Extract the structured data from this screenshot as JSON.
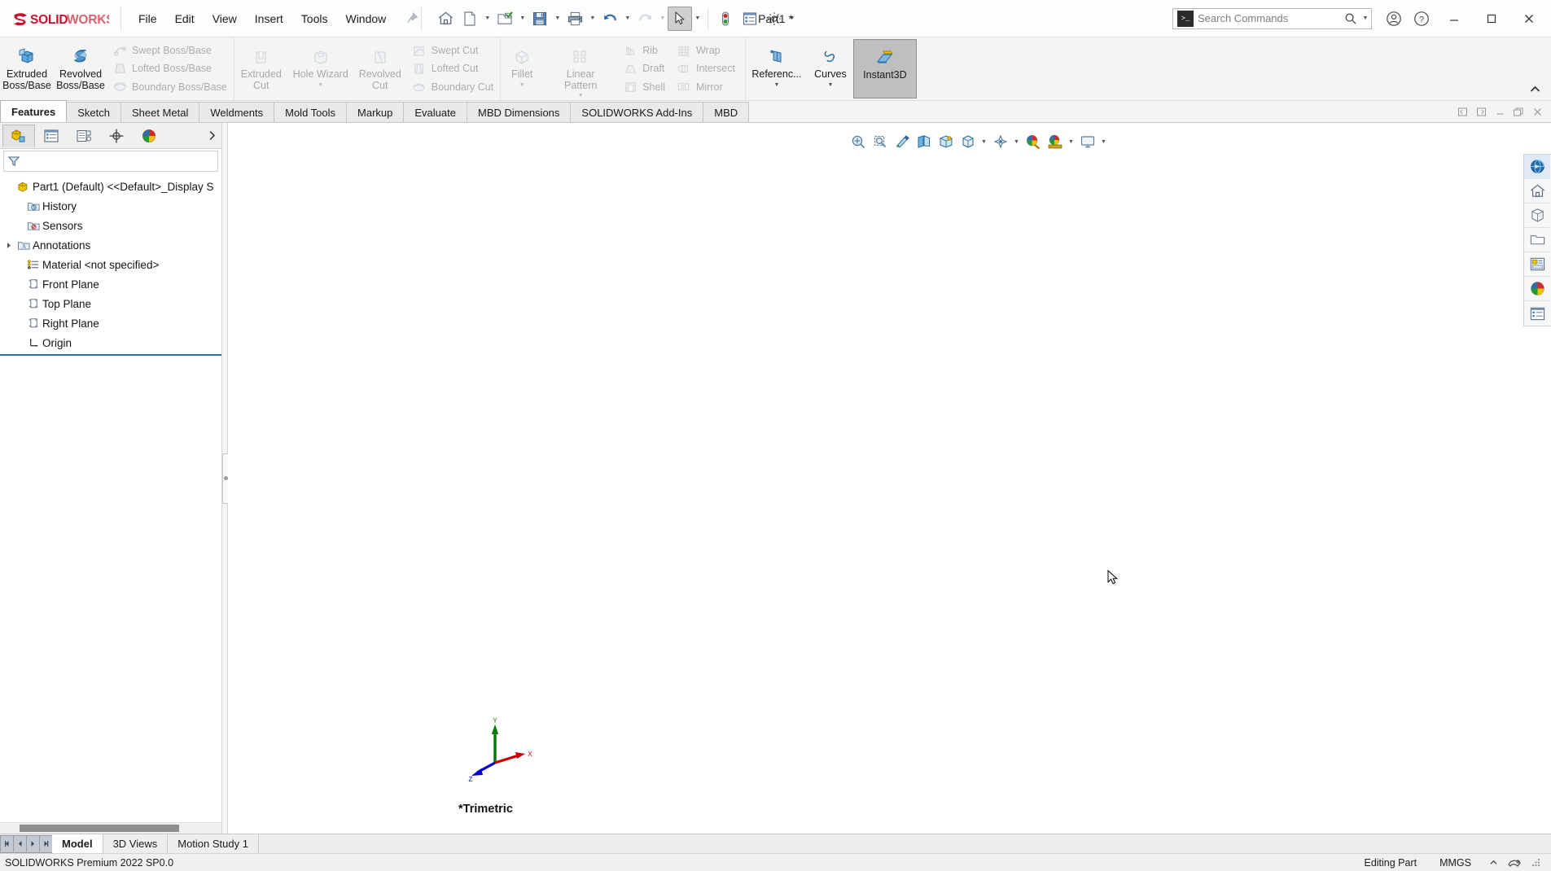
{
  "app": {
    "brand_solid": "SOLID",
    "brand_works": "WORKS",
    "document_title": "Part1 *",
    "accent_red": "#c8102e",
    "accent_blue": "#2f6fa8"
  },
  "menubar": {
    "items": [
      {
        "label": "File",
        "name": "menu-file"
      },
      {
        "label": "Edit",
        "name": "menu-edit"
      },
      {
        "label": "View",
        "name": "menu-view"
      },
      {
        "label": "Insert",
        "name": "menu-insert"
      },
      {
        "label": "Tools",
        "name": "menu-tools"
      },
      {
        "label": "Window",
        "name": "menu-window"
      }
    ],
    "pin_icon": "pin-icon"
  },
  "quick_access": {
    "buttons": [
      {
        "name": "home-button",
        "icon": "home-icon",
        "caret": false
      },
      {
        "name": "new-document-button",
        "icon": "new-document-icon",
        "caret": true
      },
      {
        "name": "open-document-button",
        "icon": "open-folder-icon",
        "caret": true
      },
      {
        "name": "save-button",
        "icon": "save-floppy-icon",
        "caret": true
      },
      {
        "name": "print-button",
        "icon": "printer-icon",
        "caret": true
      },
      {
        "name": "undo-button",
        "icon": "undo-arrow-icon",
        "caret": true
      },
      {
        "name": "redo-button",
        "icon": "redo-arrow-icon",
        "caret": true
      },
      {
        "name": "select-button",
        "icon": "cursor-arrow-icon",
        "caret": true,
        "selected": true
      },
      {
        "name": "rebuild-button",
        "icon": "traffic-light-icon",
        "caret": false
      },
      {
        "name": "file-properties-button",
        "icon": "properties-list-icon",
        "caret": false
      },
      {
        "name": "options-button",
        "icon": "gear-icon",
        "caret": true
      }
    ]
  },
  "search": {
    "placeholder": "Search Commands",
    "value": "",
    "prompt_glyph": ">_",
    "magnifier_icon": "search-icon",
    "caret_icon": "chevron-down-icon"
  },
  "title_right": {
    "account_icon": "user-account-icon",
    "help_icon": "help-question-icon",
    "minimize": "minimize-icon",
    "maximize": "maximize-icon",
    "close": "close-icon"
  },
  "ribbon": {
    "collapse_icon": "chevron-up-icon",
    "groups": [
      {
        "name": "boss-base-group",
        "big": [
          {
            "label": "Extruded\nBoss/Base",
            "name": "extruded-boss-base-button",
            "icon": "extruded-boss-icon",
            "disabled": false,
            "caret": false
          },
          {
            "label": "Revolved\nBoss/Base",
            "name": "revolved-boss-base-button",
            "icon": "revolved-boss-icon",
            "disabled": false,
            "caret": false
          }
        ],
        "small": [
          {
            "label": "Swept Boss/Base",
            "name": "swept-boss-base-button",
            "icon": "swept-boss-icon",
            "disabled": true
          },
          {
            "label": "Lofted Boss/Base",
            "name": "lofted-boss-base-button",
            "icon": "lofted-boss-icon",
            "disabled": true
          },
          {
            "label": "Boundary Boss/Base",
            "name": "boundary-boss-base-button",
            "icon": "boundary-boss-icon",
            "disabled": true
          }
        ]
      },
      {
        "name": "cut-group",
        "big": [
          {
            "label": "Extruded\nCut",
            "name": "extruded-cut-button",
            "icon": "extruded-cut-icon",
            "disabled": true,
            "caret": false
          },
          {
            "label": "Hole Wizard",
            "name": "hole-wizard-button",
            "icon": "hole-wizard-icon",
            "disabled": true,
            "caret": true
          },
          {
            "label": "Revolved\nCut",
            "name": "revolved-cut-button",
            "icon": "revolved-cut-icon",
            "disabled": true,
            "caret": false
          }
        ],
        "small": [
          {
            "label": "Swept Cut",
            "name": "swept-cut-button",
            "icon": "swept-cut-icon",
            "disabled": true
          },
          {
            "label": "Lofted Cut",
            "name": "lofted-cut-button",
            "icon": "lofted-cut-icon",
            "disabled": true
          },
          {
            "label": "Boundary Cut",
            "name": "boundary-cut-button",
            "icon": "boundary-cut-icon",
            "disabled": true
          }
        ]
      },
      {
        "name": "feature-group",
        "big": [
          {
            "label": "Fillet",
            "name": "fillet-button",
            "icon": "fillet-icon",
            "disabled": true,
            "caret": true
          },
          {
            "label": "Linear Pattern",
            "name": "linear-pattern-button",
            "icon": "linear-pattern-icon",
            "disabled": true,
            "caret": true
          }
        ],
        "small": [
          {
            "label": "Rib",
            "name": "rib-button",
            "icon": "rib-icon",
            "disabled": true
          },
          {
            "label": "Draft",
            "name": "draft-button",
            "icon": "draft-icon",
            "disabled": true
          },
          {
            "label": "Shell",
            "name": "shell-button",
            "icon": "shell-icon",
            "disabled": true
          }
        ],
        "small2": [
          {
            "label": "Wrap",
            "name": "wrap-button",
            "icon": "wrap-icon",
            "disabled": true
          },
          {
            "label": "Intersect",
            "name": "intersect-button",
            "icon": "intersect-icon",
            "disabled": true
          },
          {
            "label": "Mirror",
            "name": "mirror-button",
            "icon": "mirror-icon",
            "disabled": true
          }
        ]
      },
      {
        "name": "reference-group",
        "big": [
          {
            "label": "Referenc...",
            "name": "reference-geometry-button",
            "icon": "reference-geometry-icon",
            "disabled": false,
            "caret": true
          },
          {
            "label": "Curves",
            "name": "curves-button",
            "icon": "curves-icon",
            "disabled": false,
            "caret": true
          },
          {
            "label": "Instant3D",
            "name": "instant3d-button",
            "icon": "instant3d-icon",
            "disabled": false,
            "caret": false,
            "active": true
          }
        ]
      }
    ]
  },
  "command_tabs": {
    "items": [
      {
        "label": "Features",
        "name": "tab-features",
        "active": true
      },
      {
        "label": "Sketch",
        "name": "tab-sketch",
        "active": false
      },
      {
        "label": "Sheet Metal",
        "name": "tab-sheet-metal",
        "active": false
      },
      {
        "label": "Weldments",
        "name": "tab-weldments",
        "active": false
      },
      {
        "label": "Mold Tools",
        "name": "tab-mold-tools",
        "active": false
      },
      {
        "label": "Markup",
        "name": "tab-markup",
        "active": false
      },
      {
        "label": "Evaluate",
        "name": "tab-evaluate",
        "active": false
      },
      {
        "label": "MBD Dimensions",
        "name": "tab-mbd-dimensions",
        "active": false
      },
      {
        "label": "SOLIDWORKS Add-Ins",
        "name": "tab-solidworks-add-ins",
        "active": false
      },
      {
        "label": "MBD",
        "name": "tab-mbd",
        "active": false
      }
    ],
    "window_controls": [
      {
        "name": "restore-left-icon"
      },
      {
        "name": "restore-right-icon"
      },
      {
        "name": "minimize-doc-icon"
      },
      {
        "name": "restore-doc-icon"
      },
      {
        "name": "close-doc-icon"
      }
    ]
  },
  "feature_manager": {
    "tabs": [
      {
        "name": "feature-manager-design-tree-tab",
        "icon": "feature-tree-icon",
        "active": true
      },
      {
        "name": "property-manager-tab",
        "icon": "property-manager-icon",
        "active": false
      },
      {
        "name": "configuration-manager-tab",
        "icon": "configuration-manager-icon",
        "active": false
      },
      {
        "name": "dimxpert-manager-tab",
        "icon": "dimxpert-icon",
        "active": false
      },
      {
        "name": "display-manager-tab",
        "icon": "display-manager-icon",
        "active": false
      }
    ],
    "expander_icon": "chevron-right-icon",
    "filter": {
      "placeholder": "",
      "value": "",
      "icon": "filter-funnel-icon"
    },
    "tree": [
      {
        "label": "Part1 (Default) <<Default>_Display S",
        "name": "tree-node-part1",
        "icon": "part-icon",
        "indent": 0,
        "twisty": false
      },
      {
        "label": "History",
        "name": "tree-node-history",
        "icon": "history-icon",
        "indent": 1,
        "twisty": false
      },
      {
        "label": "Sensors",
        "name": "tree-node-sensors",
        "icon": "sensors-icon",
        "indent": 1,
        "twisty": false
      },
      {
        "label": "Annotations",
        "name": "tree-node-annotations",
        "icon": "annotations-icon",
        "indent": 1,
        "twisty": true
      },
      {
        "label": "Material <not specified>",
        "name": "tree-node-material",
        "icon": "material-icon",
        "indent": 1,
        "twisty": false
      },
      {
        "label": "Front Plane",
        "name": "tree-node-front-plane",
        "icon": "plane-icon",
        "indent": 1,
        "twisty": false
      },
      {
        "label": "Top Plane",
        "name": "tree-node-top-plane",
        "icon": "plane-icon",
        "indent": 1,
        "twisty": false
      },
      {
        "label": "Right Plane",
        "name": "tree-node-right-plane",
        "icon": "plane-icon",
        "indent": 1,
        "twisty": false
      },
      {
        "label": "Origin",
        "name": "tree-node-origin",
        "icon": "origin-icon",
        "indent": 1,
        "twisty": false
      }
    ]
  },
  "viewport": {
    "view_label": "*Trimetric",
    "triad": {
      "x_label": "X",
      "y_label": "Y",
      "z_label": "Z",
      "x_color": "#cc0000",
      "y_color": "#007a00",
      "z_color": "#0000cc"
    },
    "hud_buttons": [
      {
        "name": "zoom-to-fit-button",
        "icon": "zoom-to-fit-icon",
        "caret": false
      },
      {
        "name": "zoom-to-area-button",
        "icon": "zoom-to-area-icon",
        "caret": false
      },
      {
        "name": "previous-view-button",
        "icon": "previous-view-icon",
        "caret": false
      },
      {
        "name": "section-view-button",
        "icon": "section-view-icon",
        "caret": false
      },
      {
        "name": "view-orientation-button",
        "icon": "view-orientation-icon",
        "caret": false
      },
      {
        "name": "display-style-button",
        "icon": "display-style-icon",
        "caret": true
      },
      {
        "name": "hide-show-items-button",
        "icon": "hide-show-items-icon",
        "caret": true
      },
      {
        "name": "edit-appearance-button",
        "icon": "edit-appearance-icon",
        "caret": false
      },
      {
        "name": "apply-scene-button",
        "icon": "apply-scene-icon",
        "caret": true
      },
      {
        "name": "view-settings-button",
        "icon": "view-settings-icon",
        "caret": true
      }
    ],
    "task_pane": [
      {
        "name": "solidworks-resources-button",
        "icon": "solidworks-resources-icon",
        "active": true
      },
      {
        "name": "design-library-button",
        "icon": "design-library-home-icon",
        "active": false
      },
      {
        "name": "file-explorer-button",
        "icon": "file-explorer-box-icon",
        "active": false
      },
      {
        "name": "view-palette-button",
        "icon": "view-palette-folder-icon",
        "active": false
      },
      {
        "name": "appearances-scenes-button",
        "icon": "appearances-scenes-icon",
        "active": false
      },
      {
        "name": "custom-properties-button",
        "icon": "custom-properties-globe-icon",
        "active": false
      },
      {
        "name": "solidworks-forum-button",
        "icon": "solidworks-forum-icon",
        "active": false
      }
    ]
  },
  "document_tabs": {
    "nav": [
      {
        "name": "first-tab-button",
        "icon": "first-arrow-icon"
      },
      {
        "name": "previous-tab-button",
        "icon": "previous-arrow-icon"
      },
      {
        "name": "next-tab-button",
        "icon": "next-arrow-icon"
      },
      {
        "name": "last-tab-button",
        "icon": "last-arrow-icon"
      }
    ],
    "items": [
      {
        "label": "Model",
        "name": "doc-tab-model",
        "active": true
      },
      {
        "label": "3D Views",
        "name": "doc-tab-3d-views",
        "active": false
      },
      {
        "label": "Motion Study 1",
        "name": "doc-tab-motion-study-1",
        "active": false
      }
    ]
  },
  "status_bar": {
    "version": "SOLIDWORKS Premium 2022 SP0.0",
    "edit_mode": "Editing Part",
    "units": "MMGS",
    "units_caret": "chevron-up-icon",
    "overlay_icon": "tangent-edges-icon",
    "resize_grip": "resize-grip-icon"
  }
}
